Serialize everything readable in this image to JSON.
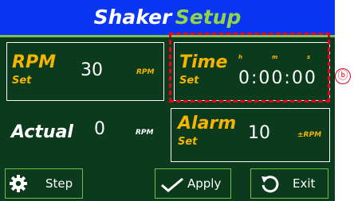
{
  "title": {
    "part1": "Shaker",
    "part2": "Setup"
  },
  "rpm_panel": {
    "label": "RPM",
    "sub": "Set",
    "value": "30",
    "unit": "RPM"
  },
  "time_panel": {
    "label": "Time",
    "sub": "Set",
    "h_label": "h",
    "m_label": "m",
    "s_label": "s",
    "value": "0:00:00"
  },
  "actual": {
    "label": "Actual",
    "value": "0",
    "unit": "RPM"
  },
  "alarm_panel": {
    "label": "Alarm",
    "sub": "Set",
    "value": "10",
    "unit": "±RPM"
  },
  "buttons": {
    "step": "Step",
    "apply": "Apply",
    "exit": "Exit"
  },
  "annotation": {
    "callout": "ⓑ"
  },
  "colors": {
    "title_bg": "#0a36f2",
    "screen_bg": "#0b3a1c",
    "accent_yellow": "#f5b400",
    "accent_green": "#6cbf4a",
    "highlight_red": "#e8001c"
  }
}
